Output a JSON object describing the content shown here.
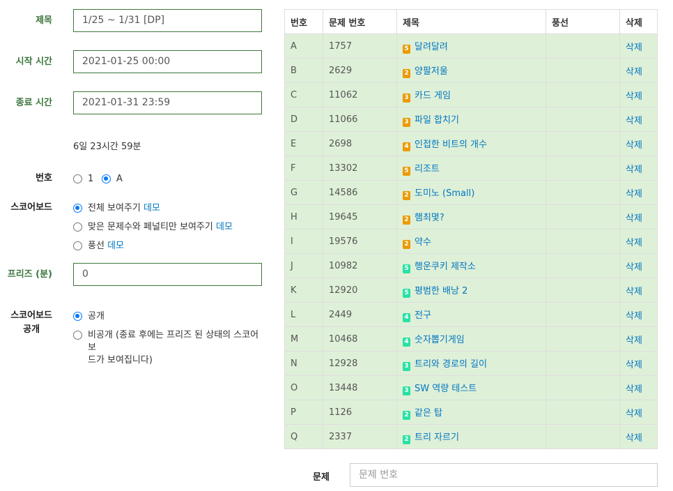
{
  "form": {
    "title_label": "제목",
    "title_value": "1/25 ~ 1/31 [DP]",
    "start_label": "시작 시간",
    "start_value": "2021-01-25 00:00",
    "end_label": "종료 시간",
    "end_value": "2021-01-31 23:59",
    "duration": "6일 23시간 59분",
    "number_label": "번호",
    "number_options": [
      {
        "label": "1",
        "checked": false
      },
      {
        "label": "A",
        "checked": true
      }
    ],
    "scoreboard_label": "스코어보드",
    "scoreboard_options": [
      {
        "label": "전체 보여주기",
        "link": "데모",
        "checked": true
      },
      {
        "label": "맞은 문제수와 페널티만 보여주기",
        "link": "데모",
        "checked": false
      },
      {
        "label": "풍선",
        "link": "데모",
        "checked": false
      }
    ],
    "freeze_label": "프리즈 (분)",
    "freeze_value": "0",
    "public_label_1": "스코어보드",
    "public_label_2": "공개",
    "public_options": [
      {
        "label": "공개",
        "checked": true
      },
      {
        "label_line1": "비공개 (종료 후에는 프리즈 된 상태의 스코어보",
        "label_line2": "드가 보여집니다)",
        "checked": false
      }
    ]
  },
  "table": {
    "headers": [
      "번호",
      "문제 번호",
      "제목",
      "풍선",
      "삭제"
    ],
    "delete_label": "삭제",
    "rows": [
      {
        "no": "A",
        "id": "1757",
        "tier": "5",
        "tier_color": "#ec9a00",
        "title": "달려달려"
      },
      {
        "no": "B",
        "id": "2629",
        "tier": "2",
        "tier_color": "#ec9a00",
        "title": "양팔저울"
      },
      {
        "no": "C",
        "id": "11062",
        "tier": "3",
        "tier_color": "#ec9a00",
        "title": "카드 게임"
      },
      {
        "no": "D",
        "id": "11066",
        "tier": "3",
        "tier_color": "#ec9a00",
        "title": "파일 합치기"
      },
      {
        "no": "E",
        "id": "2698",
        "tier": "4",
        "tier_color": "#ec9a00",
        "title": "인접한 비트의 개수"
      },
      {
        "no": "F",
        "id": "13302",
        "tier": "5",
        "tier_color": "#ec9a00",
        "title": "리조트"
      },
      {
        "no": "G",
        "id": "14586",
        "tier": "2",
        "tier_color": "#ec9a00",
        "title": "도미노 (Small)"
      },
      {
        "no": "H",
        "id": "19645",
        "tier": "2",
        "tier_color": "#ec9a00",
        "title": "햄최몇?"
      },
      {
        "no": "I",
        "id": "19576",
        "tier": "2",
        "tier_color": "#ec9a00",
        "title": "약수"
      },
      {
        "no": "J",
        "id": "10982",
        "tier": "5",
        "tier_color": "#27e2a4",
        "title": "행운쿠키 제작소"
      },
      {
        "no": "K",
        "id": "12920",
        "tier": "5",
        "tier_color": "#27e2a4",
        "title": "평범한 배낭 2"
      },
      {
        "no": "L",
        "id": "2449",
        "tier": "4",
        "tier_color": "#27e2a4",
        "title": "전구"
      },
      {
        "no": "M",
        "id": "10468",
        "tier": "4",
        "tier_color": "#27e2a4",
        "title": "숫자뽑기게임"
      },
      {
        "no": "N",
        "id": "12928",
        "tier": "3",
        "tier_color": "#27e2a4",
        "title": "트리와 경로의 길이"
      },
      {
        "no": "O",
        "id": "13448",
        "tier": "3",
        "tier_color": "#27e2a4",
        "title": "SW 역량 테스트"
      },
      {
        "no": "P",
        "id": "1126",
        "tier": "2",
        "tier_color": "#27e2a4",
        "title": "같은 탑"
      },
      {
        "no": "Q",
        "id": "2337",
        "tier": "2",
        "tier_color": "#27e2a4",
        "title": "트리 자르기"
      }
    ]
  },
  "add_problem": {
    "label": "문제",
    "placeholder": "문제 번호"
  }
}
